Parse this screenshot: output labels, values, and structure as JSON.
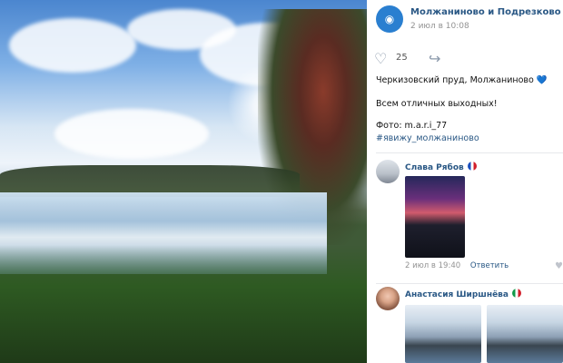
{
  "post": {
    "group_name": "Молжаниново и Подрезково",
    "timestamp": "2 июл в 10:08",
    "likes": "25",
    "text_line1": "Черкизовский пруд, Молжаниново",
    "text_line2": "Всем отличных выходных!",
    "text_line3": "Фото: m.a.r.i_77",
    "hashtag": "#явижу_молжаниново",
    "icons": {
      "avatar": "group-avatar",
      "like": "heart-icon",
      "share": "share-icon",
      "heart_emoji": "blue-heart"
    }
  },
  "comments": [
    {
      "name": "Слава Рябов",
      "meta_time": "2 июл в 19:40",
      "reply_label": "Ответить",
      "has_photo": true,
      "flag": "france-flag"
    },
    {
      "name": "Анастасия Ширшнёва",
      "flag": "italy-flag",
      "has_photos": 2
    }
  ],
  "colors": {
    "link": "#2a5885",
    "muted": "#939393",
    "divider": "#e7e8ec"
  }
}
